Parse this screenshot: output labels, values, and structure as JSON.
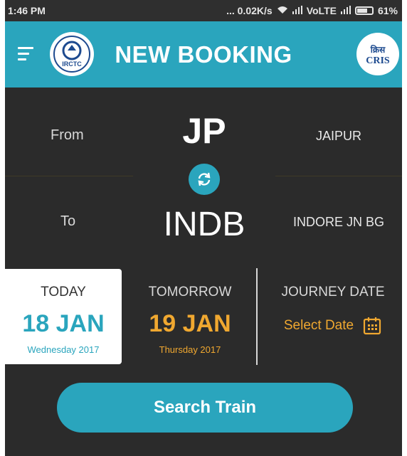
{
  "status_bar": {
    "time": "1:46 PM",
    "network_speed": "... 0.02K/s",
    "carrier": "VoLTE",
    "battery": "61%"
  },
  "header": {
    "title": "NEW BOOKING",
    "left_logo_text": "IRCTC",
    "right_logo_text": "CRIS",
    "right_logo_hindi": "क्रिस"
  },
  "from": {
    "label": "From",
    "code": "JP",
    "city": "JAIPUR"
  },
  "to": {
    "label": "To",
    "code": "INDB",
    "city": "INDORE JN BG"
  },
  "dates": {
    "today": {
      "label": "TODAY",
      "date": "18 JAN",
      "sub": "Wednesday 2017"
    },
    "tomorrow": {
      "label": "TOMORROW",
      "date": "19 JAN",
      "sub": "Thursday 2017"
    },
    "journey": {
      "label": "JOURNEY DATE",
      "action": "Select Date"
    }
  },
  "search_button": "Search Train",
  "colors": {
    "accent": "#2aa5bd",
    "background": "#2b2b2b",
    "highlight": "#f0a830",
    "today_date": "#2aa5bd"
  },
  "icons": [
    "menu-icon",
    "swap-icon",
    "calendar-icon",
    "wifi-icon",
    "signal-icon",
    "battery-icon"
  ]
}
